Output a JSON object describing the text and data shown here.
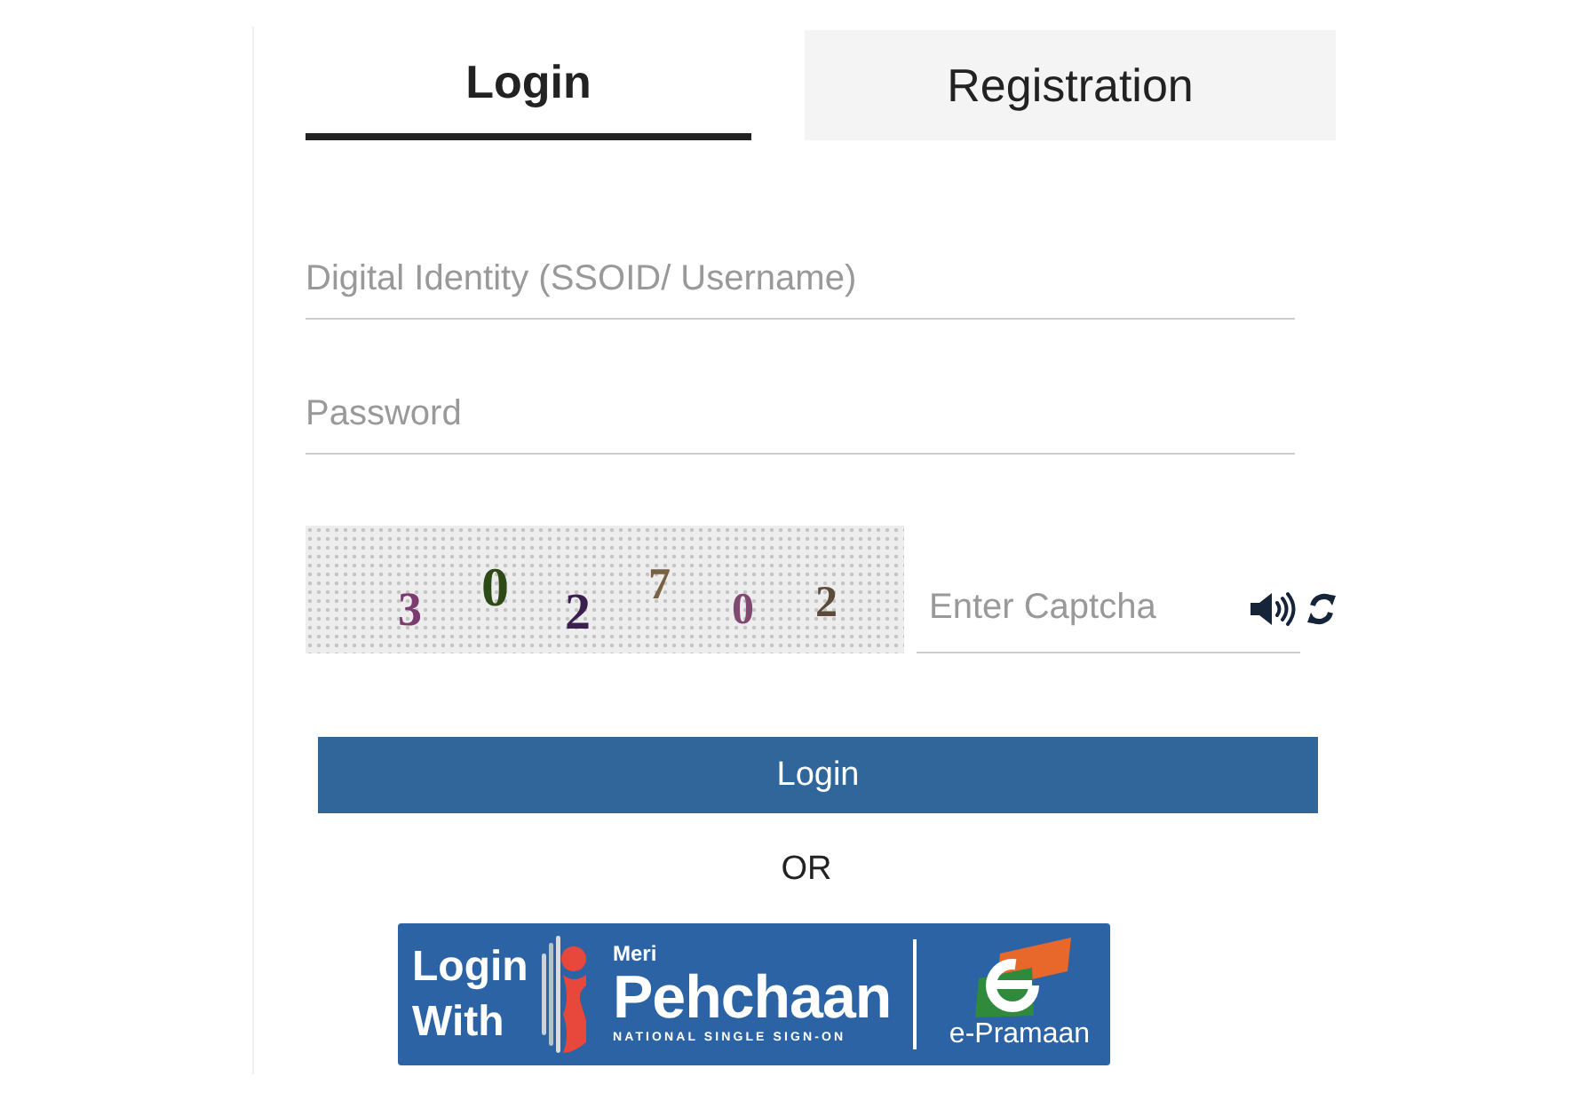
{
  "tabs": [
    {
      "label": "Login",
      "selected": true
    },
    {
      "label": "Registration",
      "selected": false
    }
  ],
  "username": {
    "placeholder": "Digital Identity (SSOID/ Username)"
  },
  "password": {
    "placeholder": "Password"
  },
  "captcha": {
    "digits": [
      {
        "text": "3",
        "color": "#7d3b6f"
      },
      {
        "text": "0",
        "color": "#2e4a17"
      },
      {
        "text": "2",
        "color": "#3b1f4f"
      },
      {
        "text": "7",
        "color": "#7a6142"
      },
      {
        "text": "0",
        "color": "#7f4a70"
      },
      {
        "text": "2",
        "color": "#5c4b3b"
      }
    ],
    "placeholder": "Enter Captcha"
  },
  "login_button": "Login",
  "separator": "OR",
  "sso_banner": {
    "lead_lines": [
      "Login",
      "With"
    ],
    "overline": "Meri",
    "brand": "Pehchaan",
    "tagline": "NATIONAL SINGLE SIGN-ON",
    "partner": "e-Pramaan"
  }
}
